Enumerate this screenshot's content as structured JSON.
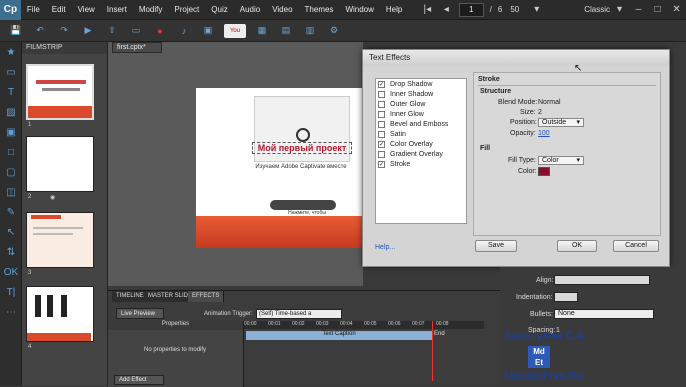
{
  "app": {
    "logo": "Cp",
    "workspace": "Classic"
  },
  "menu": [
    "File",
    "Edit",
    "View",
    "Insert",
    "Modify",
    "Project",
    "Quiz",
    "Audio",
    "Video",
    "Themes",
    "Window",
    "Help"
  ],
  "nav": {
    "current_page": "1",
    "separator": "/",
    "total_pages": "6",
    "zoom": "50"
  },
  "filmstrip": {
    "tab": "FILMSTRIP",
    "slides": [
      "1",
      "2",
      "3",
      "4"
    ]
  },
  "document": {
    "tab": "first.cptx*",
    "stage_title": "Мой первый проект",
    "stage_subtitle": "Изучаем Adobe Captivate вместе",
    "stage_hint": "Нажмите, чтобы начать проект"
  },
  "dialog": {
    "title": "Text Effects",
    "effects": [
      {
        "label": "Drop Shadow",
        "checked": true
      },
      {
        "label": "Inner Shadow",
        "checked": false
      },
      {
        "label": "Outer Glow",
        "checked": false
      },
      {
        "label": "Inner Glow",
        "checked": false
      },
      {
        "label": "Bevel and Emboss",
        "checked": false
      },
      {
        "label": "Satin",
        "checked": false
      },
      {
        "label": "Color Overlay",
        "checked": true
      },
      {
        "label": "Gradient Overlay",
        "checked": false
      },
      {
        "label": "Stroke",
        "checked": true
      }
    ],
    "group_title": "Stroke",
    "structure_label": "Structure",
    "blend_mode_label": "Blend Mode:",
    "blend_mode_value": "Normal",
    "size_label": "Size:",
    "size_value": "2",
    "position_label": "Position:",
    "position_value": "Outside",
    "opacity_label": "Opacity:",
    "opacity_value": "100",
    "fill_label": "Fill",
    "fill_type_label": "Fill Type:",
    "fill_type_value": "Color",
    "color_label": "Color:",
    "stroke_color": "#8b0d2e",
    "help": "Help...",
    "save": "Save",
    "ok": "OK",
    "cancel": "Cancel"
  },
  "timeline": {
    "tabs": [
      "TIMELINE",
      "MASTER SLIDE",
      "EFFECTS"
    ],
    "live_preview": "Live Preview",
    "animation_trigger_label": "Animation Trigger:",
    "animation_trigger_value": "(Self) Time-based a",
    "properties_label": "Properties",
    "no_properties": "No properties to modify",
    "add_effect": "Add Effect",
    "ruler": [
      "00:00",
      "00:01",
      "00:02",
      "00:03",
      "00:04",
      "00:05",
      "00:06",
      "00:07",
      "00:08"
    ],
    "track_label": "Text Caption",
    "end_label": "End"
  },
  "right_panel": {
    "align_label": "Align:",
    "indentation_label": "Indentation:",
    "bullets_label": "Bullets:",
    "bullets_value": "None",
    "spacing_label": "Spacing:",
    "spacing_value": "1"
  },
  "watermark": {
    "name": "Золотухин С.А.",
    "site": "MoodleFree.Ru",
    "badge_top": "Md",
    "badge_bottom": "Et"
  },
  "colors": {
    "accent": "#2d6ea6",
    "brand_red": "#d94a2b",
    "stroke_color": "#8b0d2e"
  }
}
